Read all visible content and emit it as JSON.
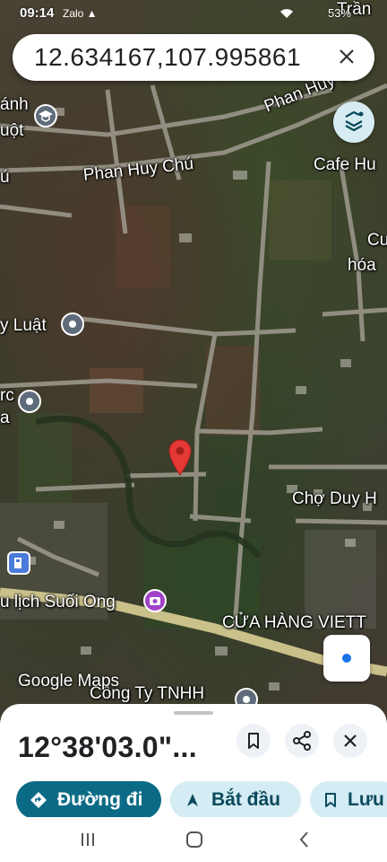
{
  "status_bar": {
    "time": "09:14",
    "notif_icons": "Zalo ▲",
    "right_text": "53%"
  },
  "search": {
    "query": "12.634167,107.995861",
    "close_icon": "close-icon"
  },
  "map": {
    "labels": {
      "phan_huy_chu_1": "Phan Huy Chú",
      "phan_huy_chu_2": "Phan Huy Chú",
      "top_left_1": "ánh",
      "top_left_2": "uột",
      "top_left_3": "ú",
      "tran": "Trần",
      "cafe": "Cafe Hu",
      "cu": "Cu",
      "hoa": "hóa",
      "luat": "y Luật",
      "rc": "rc",
      "a": "a",
      "cho": "Chợ Duy H",
      "du_lich": "u lịch Suối Ong",
      "cua_hang": "CỬA HÀNG VIETT",
      "cong_ty": "Công Ty TNHH"
    },
    "logo": "Google Maps"
  },
  "sheet": {
    "title": "12°38'03.0\"...",
    "save_icon": "bookmark-icon",
    "share_icon": "share-icon",
    "close_icon": "close-icon",
    "chips": {
      "directions": "Đường đi",
      "start": "Bắt đầu",
      "save": "Lưu"
    }
  },
  "colors": {
    "accent": "#0b6b86",
    "pin": "#e53935",
    "location_blue": "#1a73e8"
  }
}
